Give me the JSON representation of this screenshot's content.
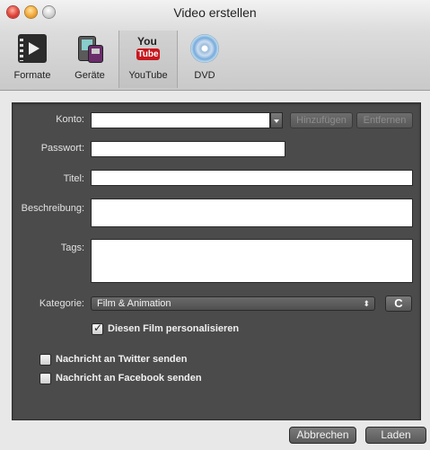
{
  "window": {
    "title": "Video erstellen"
  },
  "toolbar": {
    "items": [
      {
        "label": "Formate",
        "icon": "film-icon"
      },
      {
        "label": "Geräte",
        "icon": "devices-icon"
      },
      {
        "label": "YouTube",
        "icon": "youtube-icon",
        "selected": true
      },
      {
        "label": "DVD",
        "icon": "dvd-icon"
      }
    ]
  },
  "youtube_icon": {
    "top_text": "You",
    "bottom_text": "Tube"
  },
  "form": {
    "account": {
      "label": "Konto:",
      "value": ""
    },
    "add_button": "Hinzufügen",
    "remove_button": "Entfernen",
    "password": {
      "label": "Passwort:",
      "value": ""
    },
    "title": {
      "label": "Titel:",
      "value": ""
    },
    "description": {
      "label": "Beschreibung:",
      "value": ""
    },
    "tags": {
      "label": "Tags:",
      "value": ""
    },
    "category": {
      "label": "Kategorie:",
      "value": "Film & Animation",
      "arrows": "⬍"
    },
    "refresh_glyph": "C",
    "personalize": {
      "label": "Diesen Film personalisieren",
      "checked": true
    },
    "twitter": {
      "label": "Nachricht an Twitter senden",
      "checked": false
    },
    "facebook": {
      "label": "Nachricht an Facebook senden",
      "checked": false
    }
  },
  "footer": {
    "cancel": "Abbrechen",
    "load": "Laden"
  }
}
